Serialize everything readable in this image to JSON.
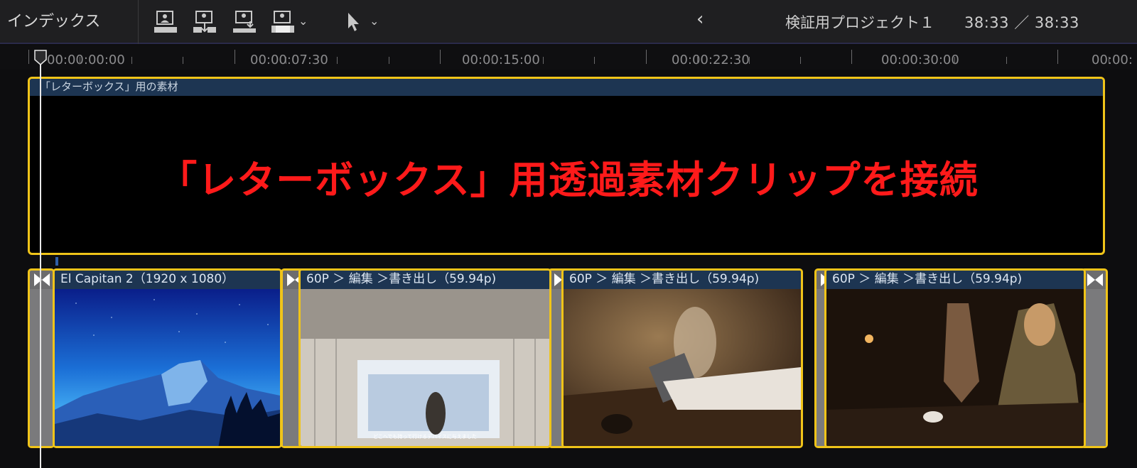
{
  "toolbar": {
    "index_label": "インデックス",
    "project_title": "検証用プロジェクト１",
    "time_display": "38:33 ／ 38:33"
  },
  "ruler": {
    "labels": [
      "00:00:00:00",
      "00:00:07:30",
      "00:00:15:00",
      "00:00:22:30",
      "00:00:30:00",
      "00:00:"
    ]
  },
  "connected_clip": {
    "name": "「レターボックス」用の素材",
    "overlay_caption": "「レターボックス」用透過素材クリップを接続"
  },
  "clips": [
    {
      "name": "El Capitan 2（1920 x 1080）"
    },
    {
      "name": "60P ＞ 編集 ＞書き出し（59.94p)",
      "subtitle": "どこへでも持って行けるデバイスに与えました"
    },
    {
      "name": "60P ＞ 編集 ＞書き出し（59.94p)"
    },
    {
      "name": "60P ＞ 編集 ＞書き出し（59.94p)"
    }
  ],
  "icons": [
    "append-clip-icon",
    "insert-clip-icon",
    "connect-clip-icon",
    "overwrite-clip-icon",
    "select-arrow-icon",
    "back-chevron-icon",
    "transition-bowtie-icon",
    "playhead-icon"
  ],
  "colors": {
    "selection_border": "#f0c419",
    "clip_label_bg": "#1d3552",
    "overlay_text": "#ff1a1a"
  }
}
